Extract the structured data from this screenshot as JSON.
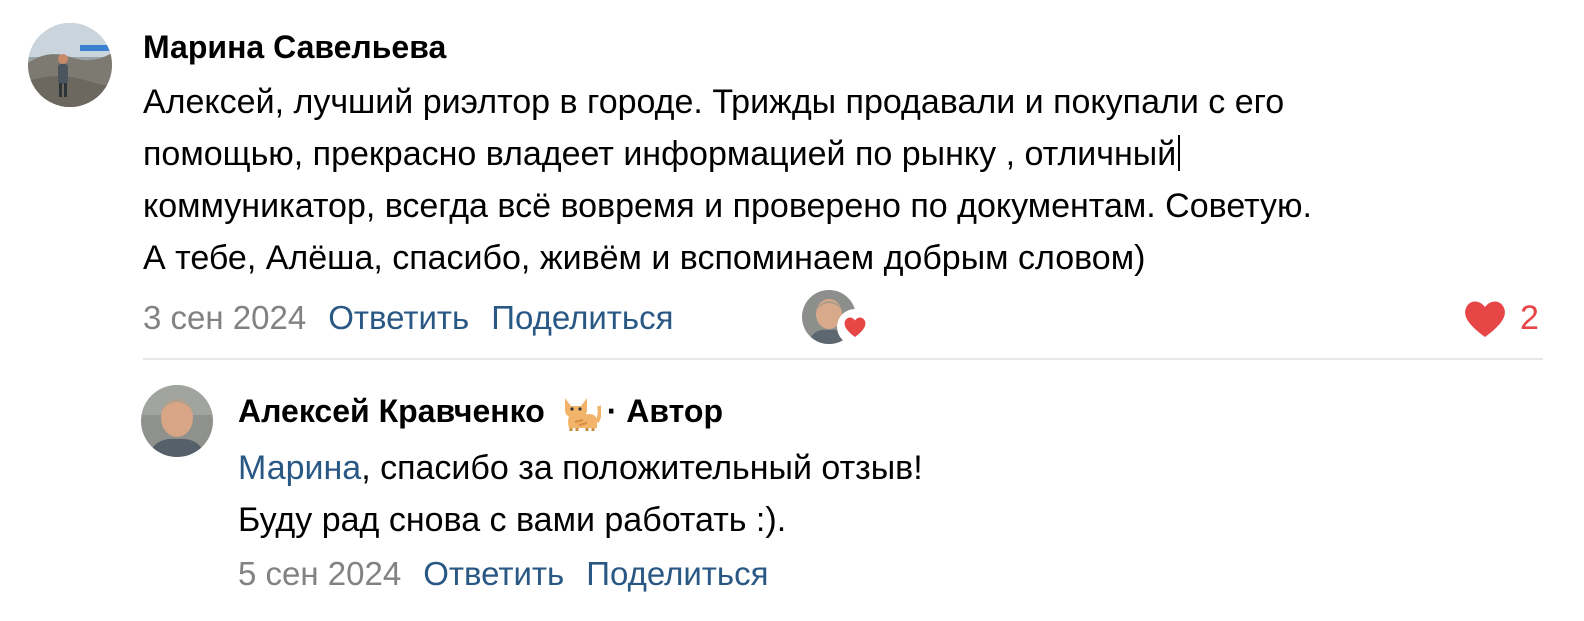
{
  "comment1": {
    "author": "Марина Савельева",
    "text_lines": [
      "Алексей, лучший риэлтор в городе. Трижды продавали и покупали с его",
      "помощью, прекрасно владеет информацией по рынку , отличный",
      "коммуникатор, всегда всё вовремя и проверено по документам. Советую.",
      "А тебе, Алёша, спасибо, живём и вспоминаем добрым словом)"
    ],
    "date": "3 сен 2024",
    "reply_label": "Ответить",
    "share_label": "Поделиться",
    "like_count": "2",
    "like_color": "#e64646"
  },
  "comment2": {
    "author": "Алексей Кравченко",
    "author_suffix": "· Автор",
    "mention": "Марина",
    "text_line1_rest": ", спасибо за положительный отзыв!",
    "text_line2": "Буду рад снова с вами работать :).",
    "date": "5 сен 2024",
    "reply_label": "Ответить",
    "share_label": "Поделиться"
  },
  "colors": {
    "link": "#2a5885",
    "muted": "#828282",
    "divider": "#e7e8ec"
  },
  "icons": {
    "like": "heart-icon",
    "author_emoji": "cat-icon"
  }
}
